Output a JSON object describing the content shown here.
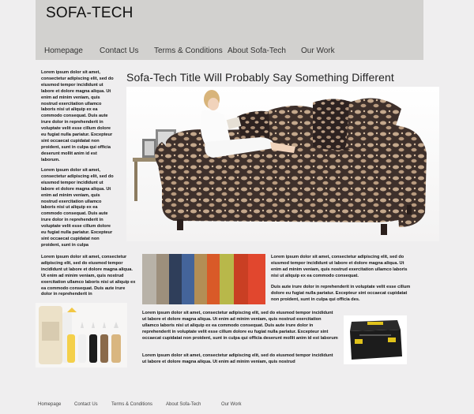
{
  "site": {
    "logo": "SOFA-TECH"
  },
  "nav": {
    "items": [
      {
        "label": "Homepage"
      },
      {
        "label": "Contact Us"
      },
      {
        "label": "Terms & Conditions"
      },
      {
        "label": "About Sofa-Tech"
      },
      {
        "label": "Our Work"
      }
    ]
  },
  "main": {
    "title": "Sofa-Tech Title Will Probably Say Something Different",
    "left_para_1": "Lorem ipsum dolor sit amet, consectetur adipiscing elit, sed do eiusmod tempor incididunt ut labore et dolore magna aliqua. Ut enim ad minim veniam, quis nostrud exercitation ullamco laboris nisi ut aliquip ex ea commodo consequat. Duis aute irure dolor in reprehenderit in voluptate velit esse cillum dolore eu fugiat nulla pariatur. Excepteur sint occaecat cupidatat non proident, sunt in culpa qui officia deserunt mollit anim id est laborum.",
    "left_para_2": "Lorem ipsum dolor sit amet, consectetur adipiscing elit, sed do eiusmod tempor incididunt ut labore et dolore magna aliqua. Ut enim ad minim veniam, quis nostrud exercitation ullamco laboris nisi ut aliquip ex ea commodo consequat. Duis aute irure dolor in reprehenderit in voluptate velit esse cillum dolore eu fugiat nulla pariatur. Excepteur sint occaecat cupidatat non proident, sunt in culpa",
    "left_para_3": "Lorem ipsum dolor sit amet, consectetur adipiscing elit, sed do eiusmod tempor incididunt ut labore et dolore magna aliqua. Ut enim ad minim veniam, quis nostrud exercitation ullamco laboris nisi ut aliquip ex ea commodo consequat. Duis aute irure dolor in reprehenderit in",
    "right_para_1": "Lorem ipsum dolor sit amet, consectetur adipiscing elit, sed do eiusmod tempor incididunt ut labore et dolore magna aliqua. Ut enim ad minim veniam, quis nostrud exercitation ullamco laboris nisi ut aliquip ex ea commodo consequat.",
    "right_para_2": "Duis aute irure dolor in reprehenderit in voluptate velit esse cillum dolore eu fugiat nulla pariatur. Excepteur sint occaecat cupidatat non proident, sunt in culpa qui officia des.",
    "center_para_1": "Lorem ipsum dolor sit amet, consectetur adipiscing elit, sed do eiusmod tempor incididunt ut labore et dolore magna aliqua. Ut enim ad minim veniam, quis nostrud exercitation ullamco laboris nisi ut aliquip ex ea commodo consequat. Duis aute irure dolor in reprehenderit in voluptate velit esse cillum dolore eu fugiat nulla pariatur. Excepteur sint occaecat cupidatat non proident, sunt in culpa qui officia deserunt mollit anim id est laborum",
    "center_para_2": "Lorem ipsum dolor sit amet, consectetur adipiscing elit, sed do eiusmod tempor incididunt ut labore et dolore magna aliqua. Ut enim ad minim veniam, quis nostrud"
  },
  "footer": {
    "items": [
      {
        "label": "Homepage"
      },
      {
        "label": "Contact Us"
      },
      {
        "label": "Terms & Conditions"
      },
      {
        "label": "About Sofa-Tech"
      },
      {
        "label": "Our Work"
      }
    ]
  },
  "images": {
    "hero": "sofa-photo",
    "fabric": "fabric-swatches-photo",
    "bottles": "repair-dye-bottles-photo",
    "toolbox": "toolbox-photo"
  }
}
